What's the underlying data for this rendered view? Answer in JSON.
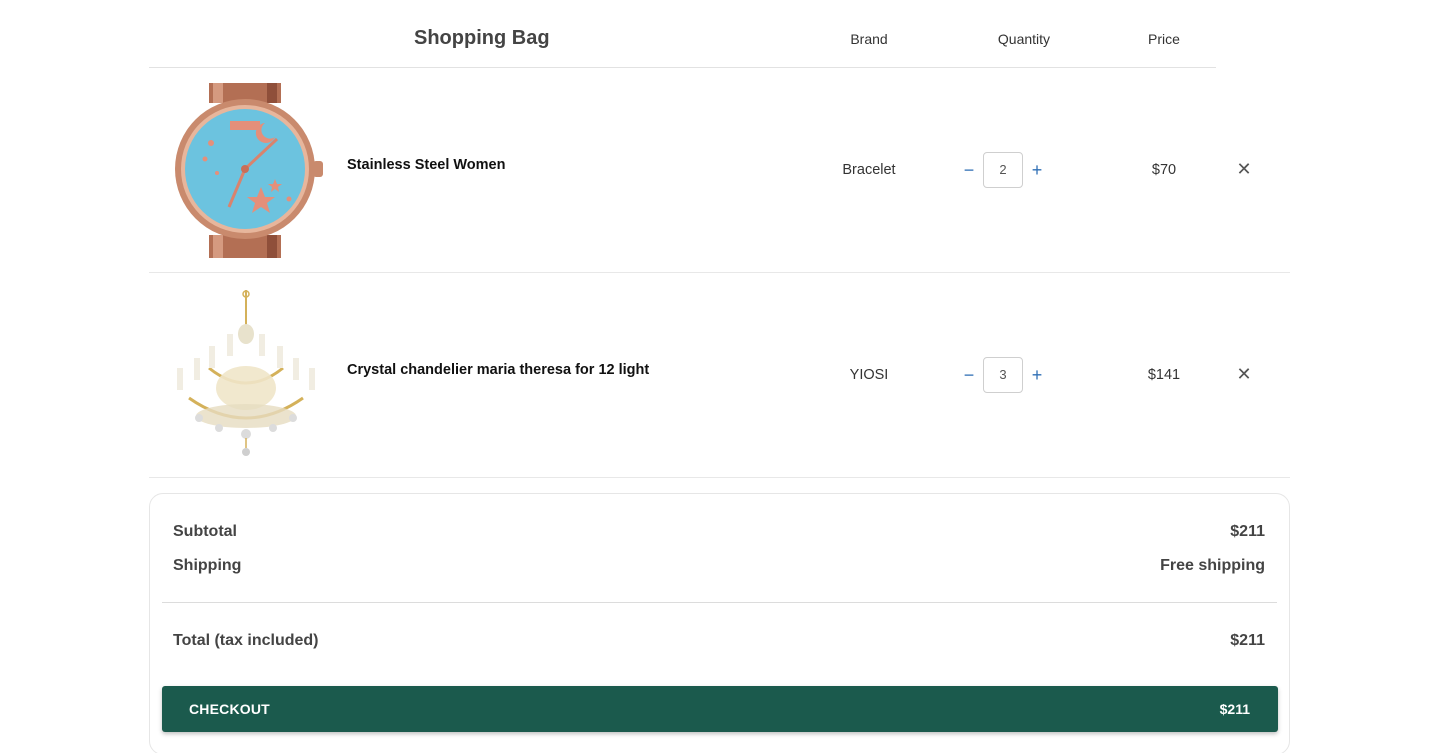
{
  "header": {
    "title": "Shopping Bag",
    "brand_col": "Brand",
    "quantity_col": "Quantity",
    "price_col": "Price"
  },
  "items": [
    {
      "name": "Stainless Steel Women",
      "brand": "Bracelet",
      "quantity": "2",
      "price": "$70",
      "image": "watch-image",
      "minus": "−",
      "plus": "+",
      "remove": "✕"
    },
    {
      "name": "Crystal chandelier maria theresa for 12 light",
      "brand": "YIOSI",
      "quantity": "3",
      "price": "$141",
      "image": "chandelier-image",
      "minus": "−",
      "plus": "+",
      "remove": "✕"
    }
  ],
  "summary": {
    "subtotal_label": "Subtotal",
    "subtotal_value": "$211",
    "shipping_label": "Shipping",
    "shipping_value": "Free shipping",
    "total_label": "Total (tax included)",
    "total_value": "$211",
    "checkout_label": "CHECKOUT",
    "checkout_price": "$211"
  },
  "colors": {
    "checkout_bg": "#1b5a4d",
    "qty_control": "#2f6fb5"
  }
}
